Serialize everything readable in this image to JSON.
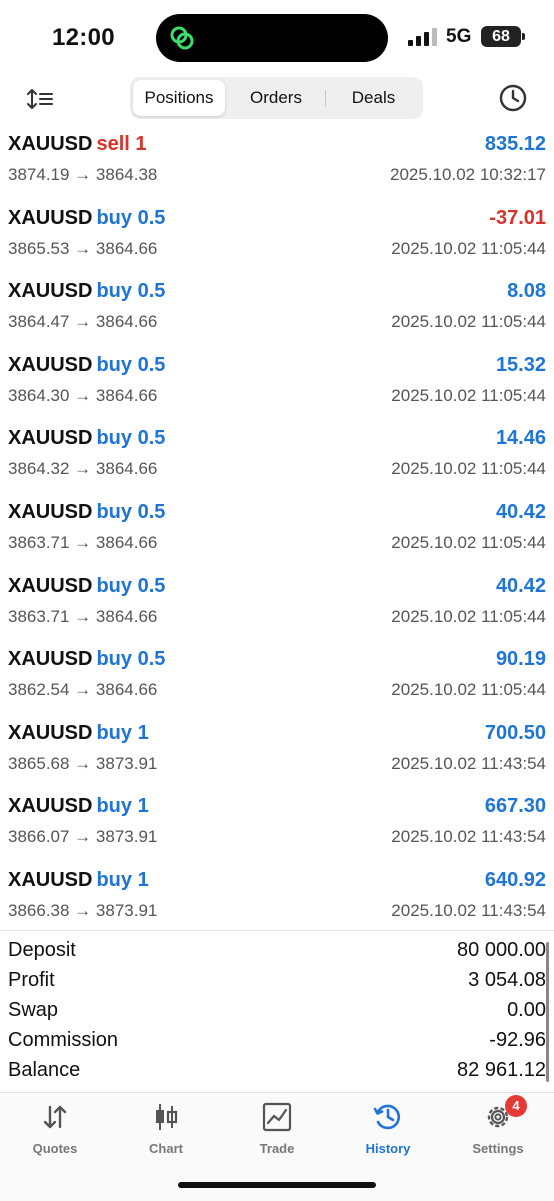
{
  "status_bar": {
    "time": "12:00",
    "network": "5G",
    "battery": "68"
  },
  "toolbar": {
    "tabs": [
      {
        "label": "Positions",
        "active": true
      },
      {
        "label": "Orders",
        "active": false
      },
      {
        "label": "Deals",
        "active": false
      }
    ],
    "icons": {
      "left": "sort-icon",
      "right": "clock-history-icon"
    }
  },
  "trades": [
    {
      "symbol": "XAUUSD",
      "side": "sell 1",
      "type": "sell",
      "open": "3874.19",
      "close": "3864.38",
      "profit": "835.12",
      "time": "2025.10.02 10:32:17"
    },
    {
      "symbol": "XAUUSD",
      "side": "buy 0.5",
      "type": "buy",
      "open": "3865.53",
      "close": "3864.66",
      "profit": "-37.01",
      "time": "2025.10.02 11:05:44"
    },
    {
      "symbol": "XAUUSD",
      "side": "buy 0.5",
      "type": "buy",
      "open": "3864.47",
      "close": "3864.66",
      "profit": "8.08",
      "time": "2025.10.02 11:05:44"
    },
    {
      "symbol": "XAUUSD",
      "side": "buy 0.5",
      "type": "buy",
      "open": "3864.30",
      "close": "3864.66",
      "profit": "15.32",
      "time": "2025.10.02 11:05:44"
    },
    {
      "symbol": "XAUUSD",
      "side": "buy 0.5",
      "type": "buy",
      "open": "3864.32",
      "close": "3864.66",
      "profit": "14.46",
      "time": "2025.10.02 11:05:44"
    },
    {
      "symbol": "XAUUSD",
      "side": "buy 0.5",
      "type": "buy",
      "open": "3863.71",
      "close": "3864.66",
      "profit": "40.42",
      "time": "2025.10.02 11:05:44"
    },
    {
      "symbol": "XAUUSD",
      "side": "buy 0.5",
      "type": "buy",
      "open": "3863.71",
      "close": "3864.66",
      "profit": "40.42",
      "time": "2025.10.02 11:05:44"
    },
    {
      "symbol": "XAUUSD",
      "side": "buy 0.5",
      "type": "buy",
      "open": "3862.54",
      "close": "3864.66",
      "profit": "90.19",
      "time": "2025.10.02 11:05:44"
    },
    {
      "symbol": "XAUUSD",
      "side": "buy 1",
      "type": "buy",
      "open": "3865.68",
      "close": "3873.91",
      "profit": "700.50",
      "time": "2025.10.02 11:43:54"
    },
    {
      "symbol": "XAUUSD",
      "side": "buy 1",
      "type": "buy",
      "open": "3866.07",
      "close": "3873.91",
      "profit": "667.30",
      "time": "2025.10.02 11:43:54"
    },
    {
      "symbol": "XAUUSD",
      "side": "buy 1",
      "type": "buy",
      "open": "3866.38",
      "close": "3873.91",
      "profit": "640.92",
      "time": "2025.10.02 11:43:54"
    }
  ],
  "summary": [
    {
      "label": "Deposit",
      "value": "80 000.00"
    },
    {
      "label": "Profit",
      "value": "3 054.08"
    },
    {
      "label": "Swap",
      "value": "0.00"
    },
    {
      "label": "Commission",
      "value": "-92.96"
    },
    {
      "label": "Balance",
      "value": "82 961.12"
    }
  ],
  "nav": [
    {
      "label": "Quotes",
      "icon": "quotes-arrows-icon",
      "active": false
    },
    {
      "label": "Chart",
      "icon": "candlestick-chart-icon",
      "active": false
    },
    {
      "label": "Trade",
      "icon": "trade-line-chart-icon",
      "active": false
    },
    {
      "label": "History",
      "icon": "history-clock-icon",
      "active": true
    },
    {
      "label": "Settings",
      "icon": "gear-icon",
      "active": false,
      "badge": "4"
    }
  ],
  "colors": {
    "accent": "#1f74d8",
    "negative": "#d8332a",
    "badge": "#e53935"
  }
}
